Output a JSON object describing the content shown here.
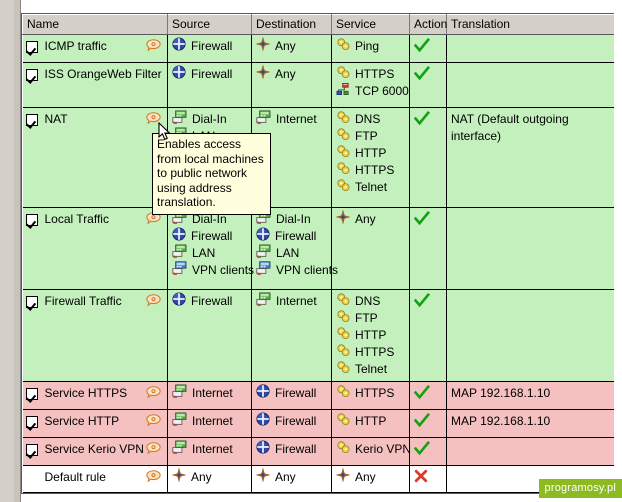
{
  "colors": {
    "row_allow": "#c3f0bd",
    "row_nat": "#f5c0c0",
    "row_default": "#ffffff",
    "header_face": "#d4d0c8",
    "tooltip_bg": "#ffffdd",
    "tick_green": "#11a111",
    "cross_red": "#d93a2b",
    "watermark_bg": "#8cba20"
  },
  "table": {
    "columns": [
      {
        "key": "name",
        "label": "Name"
      },
      {
        "key": "source",
        "label": "Source"
      },
      {
        "key": "destination",
        "label": "Destination"
      },
      {
        "key": "service",
        "label": "Service"
      },
      {
        "key": "action",
        "label": "Action"
      },
      {
        "key": "translation",
        "label": "Translation"
      }
    ],
    "rows": [
      {
        "enabled": true,
        "name": "ICMP traffic",
        "has_comment": true,
        "row_style": "green",
        "source": [
          {
            "icon": "firewall-globe-icon",
            "label": "Firewall"
          }
        ],
        "destination": [
          {
            "icon": "any-star-icon",
            "label": "Any"
          }
        ],
        "service": [
          {
            "icon": "service-gear-icon",
            "label": "Ping"
          }
        ],
        "action": "allow",
        "translation": ""
      },
      {
        "enabled": true,
        "name": "ISS OrangeWeb Filter",
        "has_comment": false,
        "row_style": "green",
        "source": [
          {
            "icon": "firewall-globe-icon",
            "label": "Firewall"
          }
        ],
        "destination": [
          {
            "icon": "any-star-icon",
            "label": "Any"
          }
        ],
        "service": [
          {
            "icon": "service-gear-icon",
            "label": "HTTPS"
          },
          {
            "icon": "port-connector-icon",
            "label": "TCP 6000"
          }
        ],
        "action": "allow",
        "translation": ""
      },
      {
        "enabled": true,
        "name": "NAT",
        "has_comment": true,
        "row_style": "green",
        "source": [
          {
            "icon": "network-interface-icon",
            "label": "Dial-In"
          },
          {
            "icon": "network-interface-icon",
            "label": "LAN"
          }
        ],
        "destination": [
          {
            "icon": "network-interface-icon",
            "label": "Internet"
          }
        ],
        "service": [
          {
            "icon": "service-gear-icon",
            "label": "DNS"
          },
          {
            "icon": "service-gear-icon",
            "label": "FTP"
          },
          {
            "icon": "service-gear-icon",
            "label": "HTTP"
          },
          {
            "icon": "service-gear-icon",
            "label": "HTTPS"
          },
          {
            "icon": "service-gear-icon",
            "label": "Telnet"
          }
        ],
        "action": "allow",
        "translation": "NAT (Default outgoing interface)"
      },
      {
        "enabled": true,
        "name": "Local Traffic",
        "has_comment": true,
        "row_style": "green",
        "source": [
          {
            "icon": "network-interface-icon",
            "label": "Dial-In"
          },
          {
            "icon": "firewall-globe-icon",
            "label": "Firewall"
          },
          {
            "icon": "network-interface-icon",
            "label": "LAN"
          },
          {
            "icon": "vpn-clients-icon",
            "label": "VPN clients"
          }
        ],
        "destination": [
          {
            "icon": "network-interface-icon",
            "label": "Dial-In"
          },
          {
            "icon": "firewall-globe-icon",
            "label": "Firewall"
          },
          {
            "icon": "network-interface-icon",
            "label": "LAN"
          },
          {
            "icon": "vpn-clients-icon",
            "label": "VPN clients"
          }
        ],
        "service": [
          {
            "icon": "any-star-icon",
            "label": "Any"
          }
        ],
        "action": "allow",
        "translation": ""
      },
      {
        "enabled": true,
        "name": "Firewall Traffic",
        "has_comment": true,
        "row_style": "green",
        "source": [
          {
            "icon": "firewall-globe-icon",
            "label": "Firewall"
          }
        ],
        "destination": [
          {
            "icon": "network-interface-icon",
            "label": "Internet"
          }
        ],
        "service": [
          {
            "icon": "service-gear-icon",
            "label": "DNS"
          },
          {
            "icon": "service-gear-icon",
            "label": "FTP"
          },
          {
            "icon": "service-gear-icon",
            "label": "HTTP"
          },
          {
            "icon": "service-gear-icon",
            "label": "HTTPS"
          },
          {
            "icon": "service-gear-icon",
            "label": "Telnet"
          }
        ],
        "action": "allow",
        "translation": ""
      },
      {
        "enabled": true,
        "name": "Service HTTPS",
        "has_comment": true,
        "row_style": "pink",
        "source": [
          {
            "icon": "network-interface-icon",
            "label": "Internet"
          }
        ],
        "destination": [
          {
            "icon": "firewall-globe-icon",
            "label": "Firewall"
          }
        ],
        "service": [
          {
            "icon": "service-gear-icon",
            "label": "HTTPS"
          }
        ],
        "action": "allow",
        "translation": "MAP 192.168.1.10"
      },
      {
        "enabled": true,
        "name": "Service HTTP",
        "has_comment": true,
        "row_style": "pink",
        "source": [
          {
            "icon": "network-interface-icon",
            "label": "Internet"
          }
        ],
        "destination": [
          {
            "icon": "firewall-globe-icon",
            "label": "Firewall"
          }
        ],
        "service": [
          {
            "icon": "service-gear-icon",
            "label": "HTTP"
          }
        ],
        "action": "allow",
        "translation": "MAP 192.168.1.10"
      },
      {
        "enabled": true,
        "name": "Service Kerio VPN",
        "has_comment": true,
        "row_style": "pink",
        "source": [
          {
            "icon": "network-interface-icon",
            "label": "Internet"
          }
        ],
        "destination": [
          {
            "icon": "firewall-globe-icon",
            "label": "Firewall"
          }
        ],
        "service": [
          {
            "icon": "service-gear-icon",
            "label": "Kerio VPN"
          }
        ],
        "action": "allow",
        "translation": ""
      },
      {
        "enabled": null,
        "name": "Default rule",
        "has_comment": true,
        "row_style": "white",
        "source": [
          {
            "icon": "any-star-icon",
            "label": "Any"
          }
        ],
        "destination": [
          {
            "icon": "any-star-icon",
            "label": "Any"
          }
        ],
        "service": [
          {
            "icon": "any-star-icon",
            "label": "Any"
          }
        ],
        "action": "deny",
        "translation": ""
      }
    ]
  },
  "tooltip": {
    "text": "Enables access from local machines to public network using address translation."
  },
  "watermark": {
    "label": "programosy.pl"
  }
}
